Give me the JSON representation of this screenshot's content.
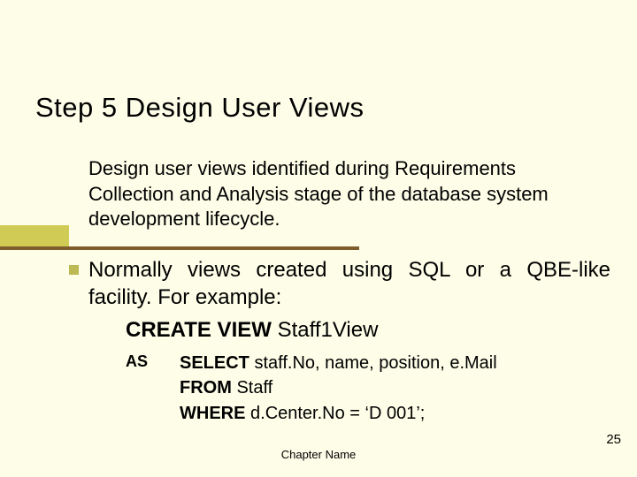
{
  "title": "Step 5  Design User Views",
  "intro": "Design user views identified during Requirements Collection and Analysis stage of the database system development lifecycle.",
  "para1": "Normally views created using SQL or a QBE-like facility. For example:",
  "create": {
    "kw": "CREATE VIEW",
    "name": " Staff1View"
  },
  "as_label": "AS",
  "sql": {
    "select_kw": "SELECT",
    "select_cols": " staff.No, name, position, e.Mail",
    "from_kw": "FROM",
    "from_tbl": " Staff",
    "where_kw": "WHERE",
    "where_cond": " d.Center.No = ‘D 001’;"
  },
  "footer": "Chapter Name",
  "page": "25"
}
